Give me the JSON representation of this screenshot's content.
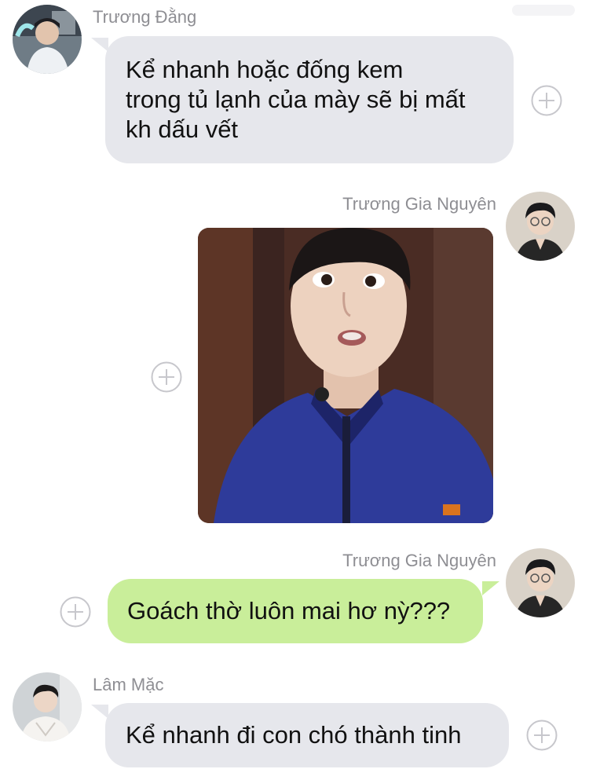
{
  "messages": [
    {
      "sender": "Trương Đằng",
      "side": "left",
      "lines": [
        "Kể nhanh hoặc đống kem",
        "trong tủ lạnh của mày sẽ bị mất",
        "kh dấu vết"
      ]
    },
    {
      "sender": "Trương Gia Nguyên",
      "side": "right",
      "type": "image"
    },
    {
      "sender": "Trương Gia Nguyên",
      "side": "right",
      "lines": [
        "Goách thờ luôn mai hơ nỳ???"
      ]
    },
    {
      "sender": "Lâm Mặc",
      "side": "left",
      "lines": [
        "Kể nhanh đi con chó thành tinh"
      ]
    }
  ],
  "colors": {
    "incoming_bubble": "#e6e7ec",
    "outgoing_bubble": "#c9ee9a",
    "sender_name": "#8e8e93",
    "plus_icon": "#c7c7cc"
  },
  "icons": [
    "avatar",
    "add-reaction-icon"
  ]
}
